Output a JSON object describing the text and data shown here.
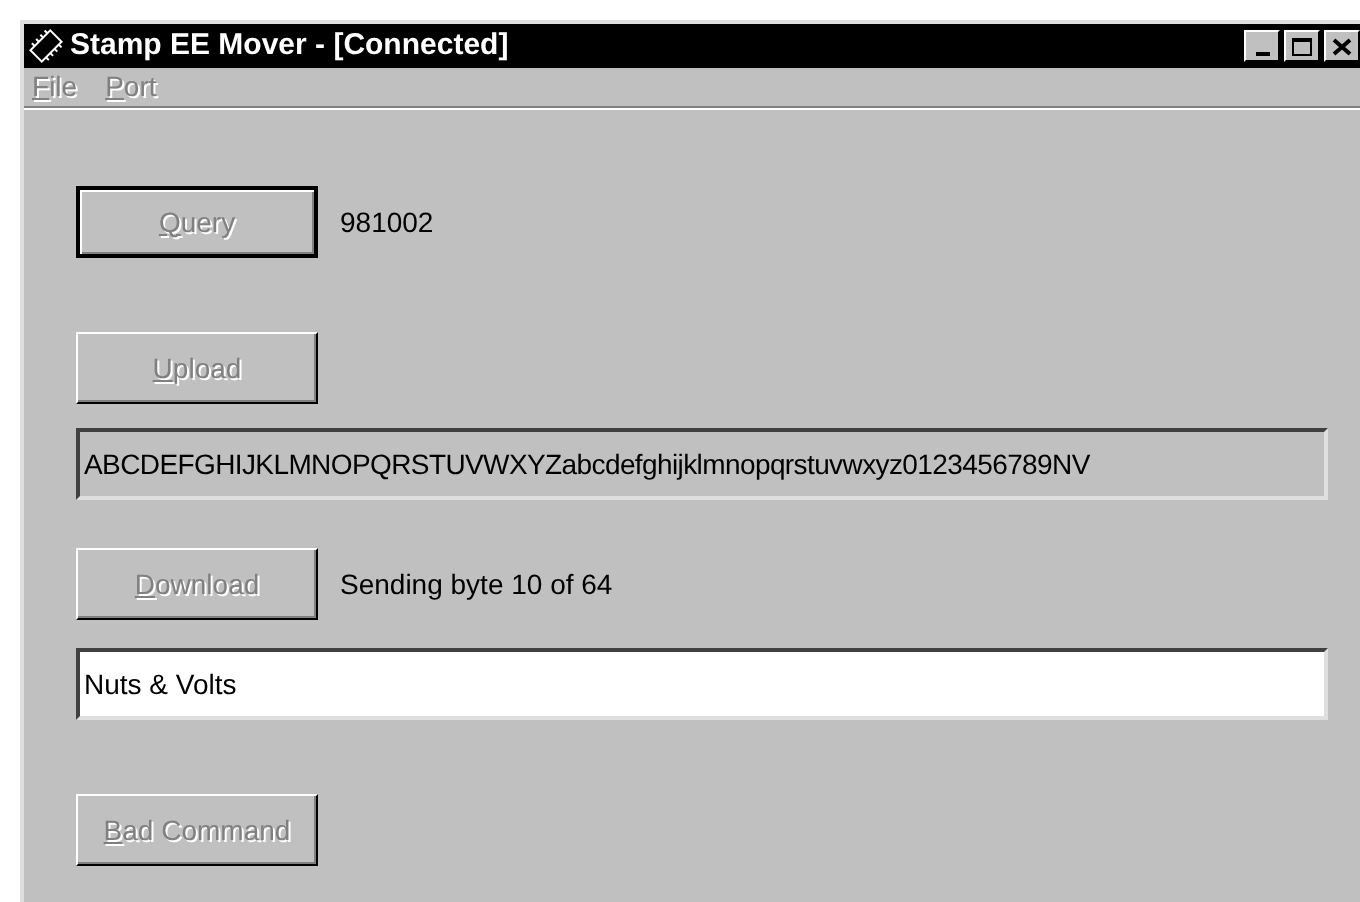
{
  "window": {
    "title": "Stamp EE Mover - [Connected]",
    "active": true
  },
  "menu": [
    {
      "label": "File",
      "disabled": true
    },
    {
      "label": "Port",
      "disabled": true
    }
  ],
  "rows": [
    {
      "kind": "button",
      "button": {
        "label": "Query",
        "disabled": true,
        "default": true
      },
      "status": "981002"
    },
    {
      "kind": "button",
      "button": {
        "label": "Upload",
        "disabled": true,
        "default": false
      }
    },
    {
      "kind": "field",
      "value": "ABCDEFGHIJKLMNOPQRSTUVWXYZabcdefghijklmnopqrstuvwxyz0123456789NV",
      "disabled": true
    },
    {
      "kind": "button",
      "button": {
        "label": "Download",
        "disabled": true,
        "default": false
      },
      "status": "Sending byte 10 of 64"
    },
    {
      "kind": "field",
      "value": "Nuts & Volts",
      "disabled": false
    },
    {
      "kind": "button",
      "button": {
        "label": "Bad Command",
        "disabled": true,
        "default": false
      }
    }
  ]
}
